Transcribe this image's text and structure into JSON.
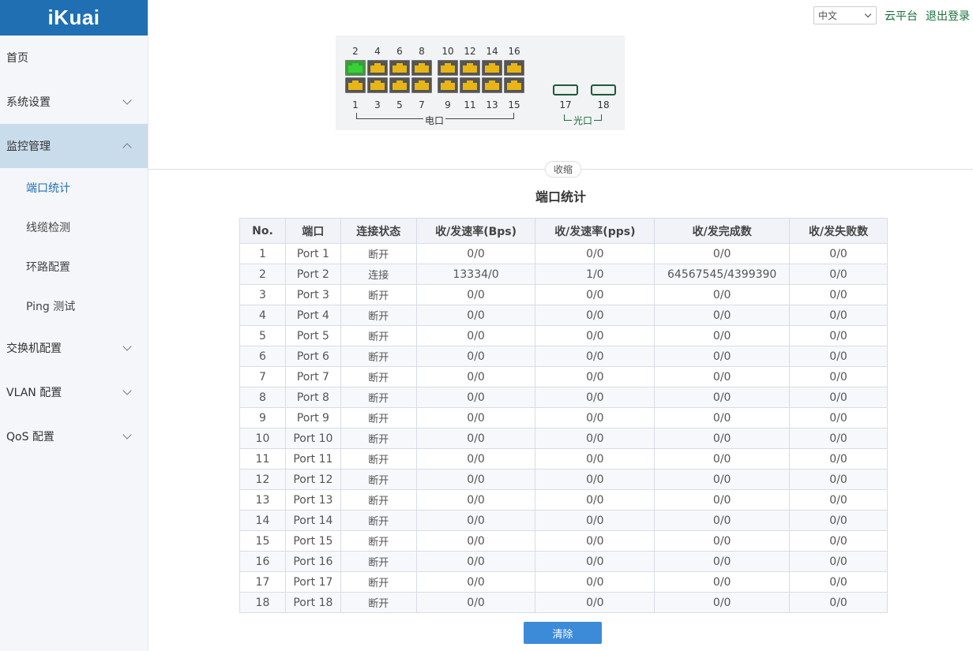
{
  "logo": "iKuai",
  "sidebar": {
    "items": [
      {
        "label": "首页"
      },
      {
        "label": "系统设置"
      },
      {
        "label": "监控管理"
      },
      {
        "label": "交换机配置"
      },
      {
        "label": "VLAN 配置"
      },
      {
        "label": "QoS 配置"
      }
    ],
    "subitems": [
      {
        "label": "端口统计"
      },
      {
        "label": "线缆检测"
      },
      {
        "label": "环路配置"
      },
      {
        "label": "Ping 测试"
      }
    ]
  },
  "topbar": {
    "language": "中文",
    "cloud": "云平台",
    "logout": "退出登录"
  },
  "panel": {
    "top_numbers": [
      "2",
      "4",
      "6",
      "8",
      "10",
      "12",
      "14",
      "16"
    ],
    "bottom_numbers": [
      "1",
      "3",
      "5",
      "7",
      "9",
      "11",
      "13",
      "15"
    ],
    "sfp_numbers": [
      "17",
      "18"
    ],
    "electric_label": "电口",
    "optical_label": "光口",
    "connected_port": "2"
  },
  "collapse": "收缩",
  "page_title": "端口统计",
  "table": {
    "headers": [
      "No.",
      "端口",
      "连接状态",
      "收/发速率(Bps)",
      "收/发速率(pps)",
      "收/发完成数",
      "收/发失败数"
    ],
    "rows": [
      [
        "1",
        "Port 1",
        "断开",
        "0/0",
        "0/0",
        "0/0",
        "0/0"
      ],
      [
        "2",
        "Port 2",
        "连接",
        "13334/0",
        "1/0",
        "64567545/4399390",
        "0/0"
      ],
      [
        "3",
        "Port 3",
        "断开",
        "0/0",
        "0/0",
        "0/0",
        "0/0"
      ],
      [
        "4",
        "Port 4",
        "断开",
        "0/0",
        "0/0",
        "0/0",
        "0/0"
      ],
      [
        "5",
        "Port 5",
        "断开",
        "0/0",
        "0/0",
        "0/0",
        "0/0"
      ],
      [
        "6",
        "Port 6",
        "断开",
        "0/0",
        "0/0",
        "0/0",
        "0/0"
      ],
      [
        "7",
        "Port 7",
        "断开",
        "0/0",
        "0/0",
        "0/0",
        "0/0"
      ],
      [
        "8",
        "Port 8",
        "断开",
        "0/0",
        "0/0",
        "0/0",
        "0/0"
      ],
      [
        "9",
        "Port 9",
        "断开",
        "0/0",
        "0/0",
        "0/0",
        "0/0"
      ],
      [
        "10",
        "Port 10",
        "断开",
        "0/0",
        "0/0",
        "0/0",
        "0/0"
      ],
      [
        "11",
        "Port 11",
        "断开",
        "0/0",
        "0/0",
        "0/0",
        "0/0"
      ],
      [
        "12",
        "Port 12",
        "断开",
        "0/0",
        "0/0",
        "0/0",
        "0/0"
      ],
      [
        "13",
        "Port 13",
        "断开",
        "0/0",
        "0/0",
        "0/0",
        "0/0"
      ],
      [
        "14",
        "Port 14",
        "断开",
        "0/0",
        "0/0",
        "0/0",
        "0/0"
      ],
      [
        "15",
        "Port 15",
        "断开",
        "0/0",
        "0/0",
        "0/0",
        "0/0"
      ],
      [
        "16",
        "Port 16",
        "断开",
        "0/0",
        "0/0",
        "0/0",
        "0/0"
      ],
      [
        "17",
        "Port 17",
        "断开",
        "0/0",
        "0/0",
        "0/0",
        "0/0"
      ],
      [
        "18",
        "Port 18",
        "断开",
        "0/0",
        "0/0",
        "0/0",
        "0/0"
      ]
    ]
  },
  "clear_button": "清除",
  "colors": {
    "brand": "#1f6fb2",
    "link": "#1a6e3a",
    "port_up": "#37d037",
    "port_down": "#e8b516",
    "button": "#3c8bd9"
  }
}
